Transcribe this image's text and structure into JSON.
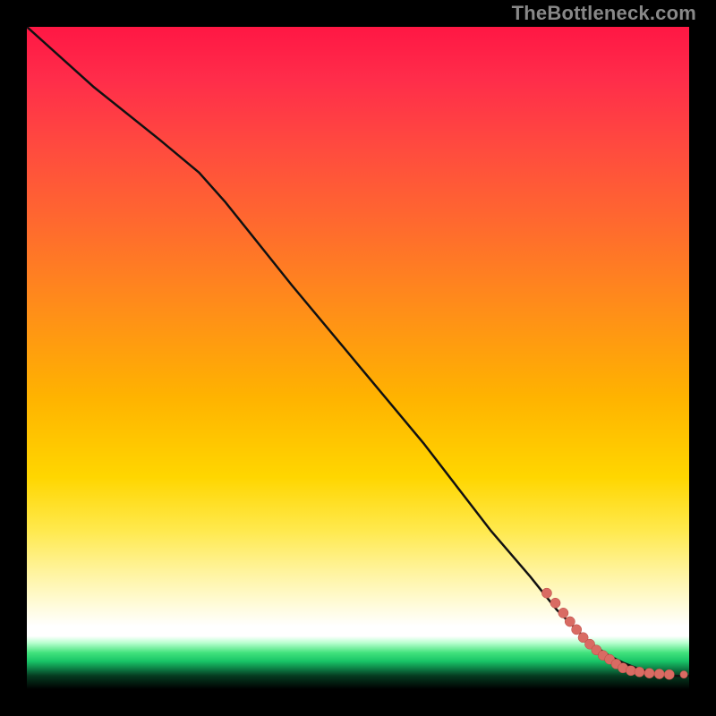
{
  "attribution": "TheBottleneck.com",
  "colors": {
    "background": "#000000",
    "curve": "#111111",
    "point_fill": "#d96b63",
    "point_stroke": "#b84a42",
    "gradient_stops": [
      "#ff1744",
      "#ff6a2e",
      "#ffd600",
      "#ffffff",
      "#42e27c",
      "#000000"
    ]
  },
  "chart_data": {
    "type": "line",
    "title": "",
    "xlabel": "",
    "ylabel": "",
    "xlim": [
      0,
      100
    ],
    "ylim": [
      0,
      100
    ],
    "grid": false,
    "legend": null,
    "series": [
      {
        "name": "bottleneck-curve",
        "x": [
          0,
          10,
          20,
          26,
          30,
          40,
          50,
          60,
          70,
          76,
          80,
          85,
          88,
          90,
          92,
          94,
          96,
          98,
          100
        ],
        "y": [
          100,
          91,
          83,
          78,
          73.5,
          61,
          49,
          37,
          24,
          17,
          12,
          7,
          5,
          4,
          3.2,
          2.6,
          2.2,
          2.0,
          2.0
        ]
      }
    ],
    "points": [
      {
        "x": 78.5,
        "y": 14.5
      },
      {
        "x": 79.8,
        "y": 13.0
      },
      {
        "x": 81.0,
        "y": 11.5
      },
      {
        "x": 82.0,
        "y": 10.2
      },
      {
        "x": 83.0,
        "y": 9.0
      },
      {
        "x": 84.0,
        "y": 7.8
      },
      {
        "x": 85.0,
        "y": 6.8
      },
      {
        "x": 86.0,
        "y": 5.9
      },
      {
        "x": 87.0,
        "y": 5.1
      },
      {
        "x": 88.0,
        "y": 4.5
      },
      {
        "x": 89.0,
        "y": 3.8
      },
      {
        "x": 90.0,
        "y": 3.2
      },
      {
        "x": 91.2,
        "y": 2.8
      },
      {
        "x": 92.5,
        "y": 2.6
      },
      {
        "x": 94.0,
        "y": 2.4
      },
      {
        "x": 95.5,
        "y": 2.3
      },
      {
        "x": 97.0,
        "y": 2.2
      },
      {
        "x": 99.2,
        "y": 2.2
      }
    ],
    "annotations": []
  }
}
